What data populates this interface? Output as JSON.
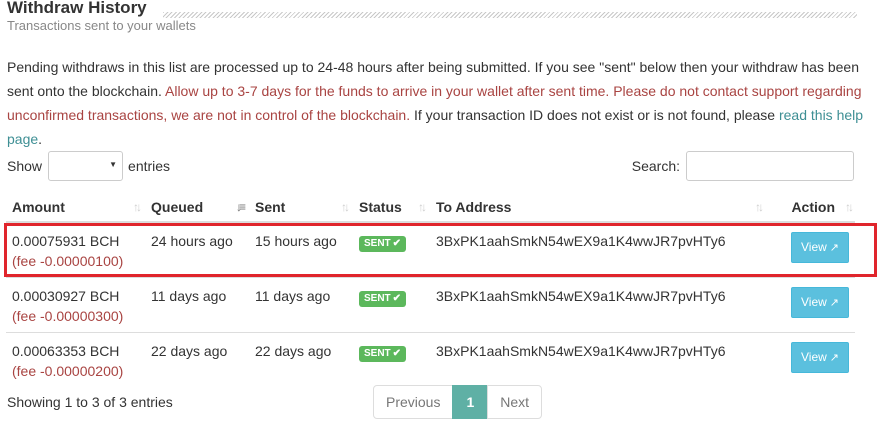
{
  "header": {
    "title": "Withdraw History",
    "subtitle": "Transactions sent to your wallets"
  },
  "notice": {
    "part1": "Pending withdraws in this list are processed up to 24-48 hours after being submitted. If you see \"sent\" below then your withdraw has been sent onto the blockchain. ",
    "warning": "Allow up to 3-7 days for the funds to arrive in your wallet after sent time. Please do not contact support regarding unconfirmed transactions, we are not in control of the blockchain.",
    "part2": " If your transaction ID does not exist or is not found, please ",
    "link": "read this help page",
    "end": "."
  },
  "controls": {
    "show_label": "Show",
    "entries_label": "entries",
    "entries_value": "",
    "search_label": "Search:",
    "search_value": ""
  },
  "table": {
    "columns": [
      "Amount",
      "Queued",
      "Sent",
      "Status",
      "To Address",
      "Action"
    ],
    "rows": [
      {
        "amount": "0.00075931 BCH",
        "fee": "(fee -0.00000100)",
        "queued": "24 hours ago",
        "sent": "15 hours ago",
        "status": "SENT",
        "address": "3BxPK1aahSmkN54wEX9a1K4wwJR7pvHTy6",
        "action": "View"
      },
      {
        "amount": "0.00030927 BCH",
        "fee": "(fee -0.00000300)",
        "queued": "11 days ago",
        "sent": "11 days ago",
        "status": "SENT",
        "address": "3BxPK1aahSmkN54wEX9a1K4wwJR7pvHTy6",
        "action": "View"
      },
      {
        "amount": "0.00063353 BCH",
        "fee": "(fee -0.00000200)",
        "queued": "22 days ago",
        "sent": "22 days ago",
        "status": "SENT",
        "address": "3BxPK1aahSmkN54wEX9a1K4wwJR7pvHTy6",
        "action": "View"
      }
    ]
  },
  "footer": {
    "info": "Showing 1 to 3 of 3 entries",
    "previous": "Previous",
    "page": "1",
    "next": "Next"
  },
  "icons": {
    "check": "check-icon",
    "external_link": "external-link-icon",
    "sort": "sort-icon"
  },
  "colors": {
    "sent_badge": "#5cb85c",
    "view_button": "#5bc0de",
    "active_page": "#5fb0a5",
    "warning_text": "#a94442",
    "link_text": "#3e8f94",
    "highlight_box": "#e0252c"
  }
}
